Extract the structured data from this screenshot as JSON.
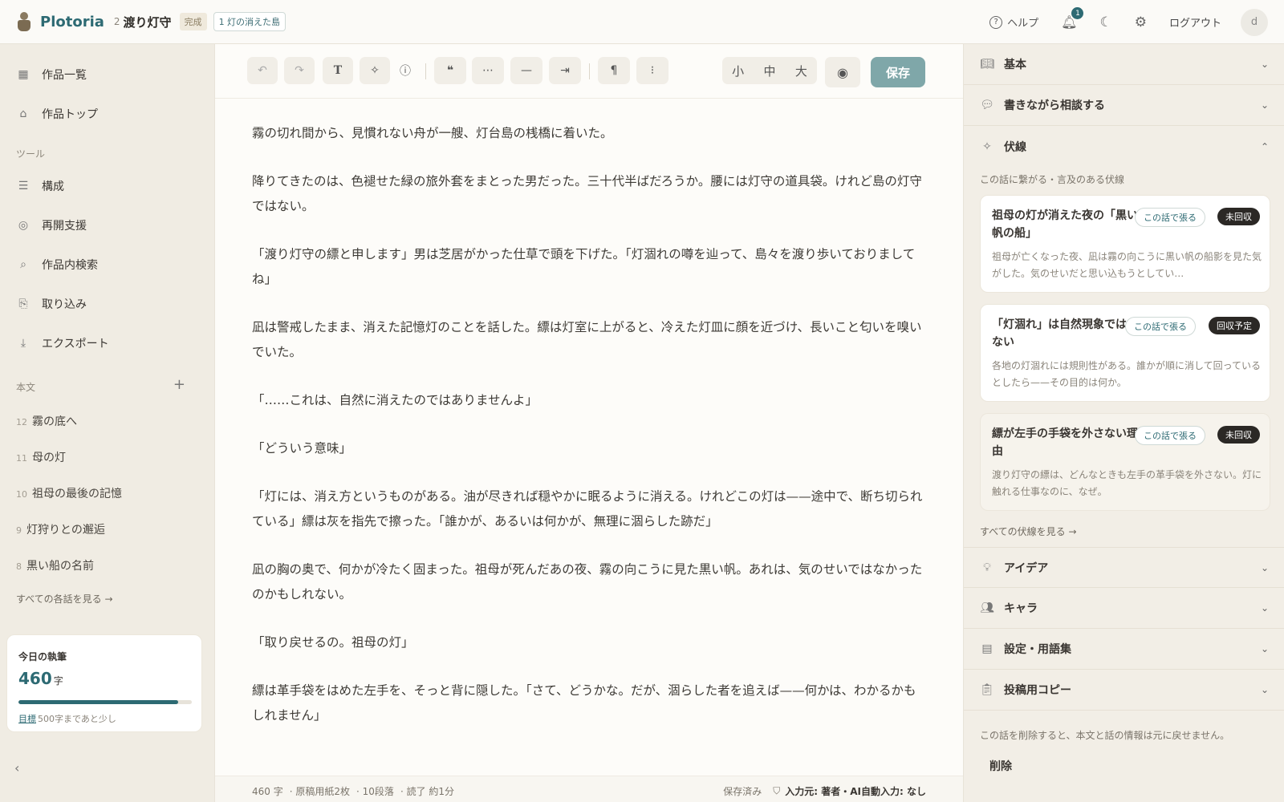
{
  "header": {
    "app_name": "Plotoria",
    "episode_number": "2",
    "work_title": "渡り灯守",
    "status_badge": "完成",
    "episode_pill": "1 灯の消えた島",
    "help_label": "ヘルプ",
    "notification_count": "1",
    "logout_label": "ログアウト",
    "avatar_initial": "d"
  },
  "sidebar": {
    "nav": [
      {
        "label": "作品一覧",
        "icon": "grid-icon"
      },
      {
        "label": "作品トップ",
        "icon": "home-icon"
      }
    ],
    "tools_label": "ツール",
    "tools": [
      {
        "label": "構成",
        "icon": "list-icon"
      },
      {
        "label": "再開支援",
        "icon": "lifebuoy-icon"
      },
      {
        "label": "作品内検索",
        "icon": "search-icon"
      },
      {
        "label": "取り込み",
        "icon": "import-icon"
      },
      {
        "label": "エクスポート",
        "icon": "download-icon"
      }
    ],
    "body_label": "本文",
    "episodes": [
      {
        "num": "12",
        "title": "霧の底へ"
      },
      {
        "num": "11",
        "title": "母の灯"
      },
      {
        "num": "10",
        "title": "祖母の最後の記憶"
      },
      {
        "num": "9",
        "title": "灯狩りとの邂逅"
      },
      {
        "num": "8",
        "title": "黒い船の名前"
      }
    ],
    "all_episodes_link": "すべての各話を見る →",
    "today": {
      "label": "今日の執筆",
      "count": "460",
      "unit": "字",
      "progress": 0.92,
      "goal_link": "目標",
      "goal_text": "500字まであと少し"
    }
  },
  "editor": {
    "toolbar": {
      "size_small": "小",
      "size_medium": "中",
      "size_large": "大",
      "save_label": "保存"
    },
    "paragraphs": [
      "霧の切れ間から、見慣れない舟が一艘、灯台島の桟橋に着いた。",
      "降りてきたのは、色褪せた緑の旅外套をまとった男だった。三十代半ばだろうか。腰には灯守の道具袋。けれど島の灯守ではない。",
      "「渡り灯守の縹と申します」男は芝居がかった仕草で頭を下げた。「灯涸れの噂を辿って、島々を渡り歩いておりましてね」",
      "凪は警戒したまま、消えた記憶灯のことを話した。縹は灯室に上がると、冷えた灯皿に顔を近づけ、長いこと匂いを嗅いでいた。",
      "「……これは、自然に消えたのではありませんよ」",
      "「どういう意味」",
      "「灯には、消え方というものがある。油が尽きれば穏やかに眠るように消える。けれどこの灯は——途中で、断ち切られている」縹は灰を指先で擦った。「誰かが、あるいは何かが、無理に涸らした跡だ」",
      "凪の胸の奥で、何かが冷たく固まった。祖母が死んだあの夜、霧の向こうに見た黒い帆。あれは、気のせいではなかったのかもしれない。",
      "「取り戻せるの。祖母の灯」",
      "縹は革手袋をはめた左手を、そっと背に隠した。「さて、どうかな。だが、涸らした者を追えば——何かは、わかるかもしれません」"
    ],
    "status": {
      "chars": "460 字",
      "pages": "原稿用紙2枚",
      "paragraphs": "10段落",
      "read_time": "読了 約1分",
      "saved": "保存済み",
      "source": "入力元: 著者・AI自動入力: なし"
    }
  },
  "panel": {
    "sections_top": [
      {
        "label": "基本",
        "icon": "book-icon",
        "chevron": "⌄"
      },
      {
        "label": "書きながら相談する",
        "icon": "chat-icon",
        "chevron": "⌄"
      },
      {
        "label": "伏線",
        "icon": "sparkle-icon",
        "chevron": "⌃"
      }
    ],
    "foreshadow_caption": "この話に繋がる・言及のある伏線",
    "foreshadows": [
      {
        "title": "祖母の灯が消えた夜の「黒い帆の船」",
        "plant": "この話で張る",
        "status": "未回収",
        "desc": "祖母が亡くなった夜、凪は霧の向こうに黒い帆の船影を見た気がした。気のせいだと思い込もうとしてい…"
      },
      {
        "title": "「灯涸れ」は自然現象ではない",
        "plant": "この話で張る",
        "status": "回収予定",
        "desc": "各地の灯涸れには規則性がある。誰かが順に消して回っているとしたら——その目的は何か。"
      },
      {
        "title": "縹が左手の手袋を外さない理由",
        "plant": "この話で張る",
        "status": "未回収",
        "desc": "渡り灯守の縹は、どんなときも左手の革手袋を外さない。灯に触れる仕事なのに、なぜ。"
      }
    ],
    "all_foreshadows_link": "すべての伏線を見る →",
    "sections_bottom": [
      {
        "label": "アイデア",
        "icon": "bulb-icon"
      },
      {
        "label": "キャラ",
        "icon": "users-icon"
      },
      {
        "label": "設定・用語集",
        "icon": "notebook-icon"
      },
      {
        "label": "投稿用コピー",
        "icon": "clipboard-icon"
      }
    ],
    "delete_note": "この話を削除すると、本文と話の情報は元に戻せません。",
    "delete_label": "削除"
  },
  "colors": {
    "accent": "#2d6a73",
    "save_button": "#7fa7a9",
    "status_dark": "#2b2825"
  }
}
